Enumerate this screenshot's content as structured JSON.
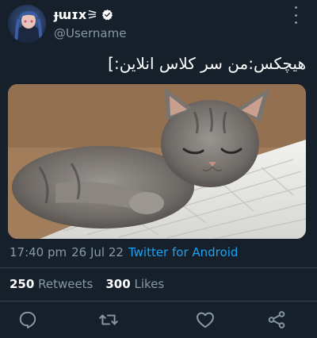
{
  "user": {
    "display_name": "ɟɯɪx⚞",
    "handle": "@Username",
    "verified": true
  },
  "tweet": {
    "text": "هیچکس:من سر کلاس انلاین:]",
    "media_description": "Kitten sleeping on a keyboard",
    "time": "17:40 pm",
    "date": "26 Jul 22",
    "source": "Twitter for Android"
  },
  "stats": {
    "retweets_count": "250",
    "retweets_label": "Retweets",
    "likes_count": "300",
    "likes_label": "Likes"
  },
  "actions": [
    "reply-icon",
    "retweet-icon",
    "like-icon",
    "share-icon"
  ],
  "colors": {
    "background": "#15202b",
    "secondary_text": "#8899a6",
    "accent": "#1da1f2",
    "divider": "#38444d"
  }
}
